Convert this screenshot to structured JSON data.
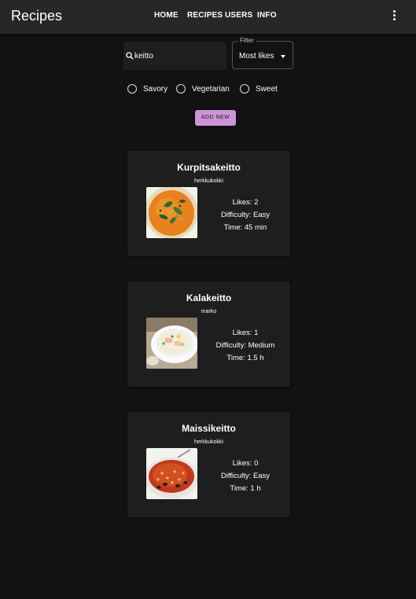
{
  "app": {
    "title": "Recipes"
  },
  "nav": {
    "home": "HOME",
    "recipes": "RECIPES",
    "users": "USERS",
    "info": "INFO"
  },
  "icons": {
    "menu": "more-vert-icon",
    "search": "search-icon"
  },
  "search": {
    "value": "keitto"
  },
  "filter": {
    "label": "Filter",
    "selected": "Most likes"
  },
  "categories": [
    "Savory",
    "Vegetarian",
    "Sweet"
  ],
  "add_button": "ADD NEW",
  "accent_color": "#ce93d8",
  "recipes": [
    {
      "title": "Kurpitsakeitto",
      "author": "herkkukokki",
      "likes": "Likes: 2",
      "difficulty": "Difficulty: Easy",
      "time": "Time: 45 min"
    },
    {
      "title": "Kalakeitto",
      "author": "marko",
      "likes": "Likes: 1",
      "difficulty": "Difficulty: Medium",
      "time": "Time: 1.5 h"
    },
    {
      "title": "Maissikeitto",
      "author": "herkkukokki",
      "likes": "Likes: 0",
      "difficulty": "Difficulty: Easy",
      "time": "Time: 1 h"
    }
  ]
}
